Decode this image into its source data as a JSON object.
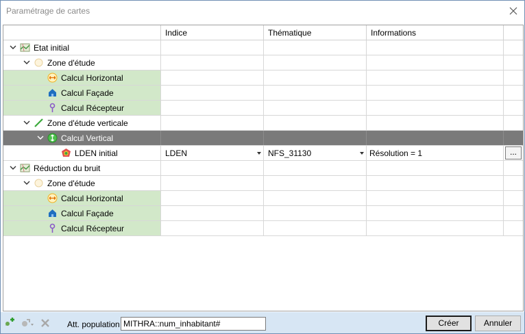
{
  "window": {
    "title": "Paramétrage de cartes"
  },
  "grid": {
    "columns": [
      "",
      "Indice",
      "Thématique",
      "Informations"
    ],
    "rows": [
      {
        "label": "Etat initial",
        "level": 0,
        "expander": "open",
        "icon": "map-icon",
        "style": "normal"
      },
      {
        "label": "Zone d'étude",
        "level": 1,
        "expander": "open",
        "icon": "zone-icon",
        "style": "normal"
      },
      {
        "label": "Calcul Horizontal",
        "level": 2,
        "expander": "none",
        "icon": "horizontal-arrows-icon",
        "style": "green"
      },
      {
        "label": "Calcul Façade",
        "level": 2,
        "expander": "none",
        "icon": "house-icon",
        "style": "green"
      },
      {
        "label": "Calcul Récepteur",
        "level": 2,
        "expander": "none",
        "icon": "receptor-pin-icon",
        "style": "green"
      },
      {
        "label": "Zone d'étude verticale",
        "level": 1,
        "expander": "open",
        "icon": "diagonal-line-icon",
        "style": "normal"
      },
      {
        "label": "Calcul Vertical",
        "level": 2,
        "expander": "open",
        "icon": "vertical-arrows-icon",
        "style": "selected"
      },
      {
        "label": "LDEN initial",
        "level": 3,
        "expander": "none",
        "icon": "noise-map-icon",
        "style": "normal",
        "indice": "LDEN",
        "thematique": "NFS_31130",
        "informations": "Résolution = 1",
        "button": "..."
      },
      {
        "label": "Réduction du bruit",
        "level": 0,
        "expander": "open",
        "icon": "map-icon",
        "style": "normal"
      },
      {
        "label": "Zone d'étude",
        "level": 1,
        "expander": "open",
        "icon": "zone-icon",
        "style": "normal"
      },
      {
        "label": "Calcul Horizontal",
        "level": 2,
        "expander": "none",
        "icon": "horizontal-arrows-icon",
        "style": "green"
      },
      {
        "label": "Calcul Façade",
        "level": 2,
        "expander": "none",
        "icon": "house-icon",
        "style": "green"
      },
      {
        "label": "Calcul Récepteur",
        "level": 2,
        "expander": "none",
        "icon": "receptor-pin-icon",
        "style": "green"
      }
    ]
  },
  "footer": {
    "toolbar_icons": [
      "add-map-icon",
      "edit-map-icon",
      "delete-icon"
    ],
    "att_label": "Att. population",
    "att_value": "MITHRA::num_inhabitant#",
    "create_label": "Créer",
    "cancel_label": "Annuler"
  },
  "colors": {
    "green_cell": "#d2e8c9",
    "selected_row": "#7a7a7a",
    "footer_bg": "#d7e6f4"
  }
}
